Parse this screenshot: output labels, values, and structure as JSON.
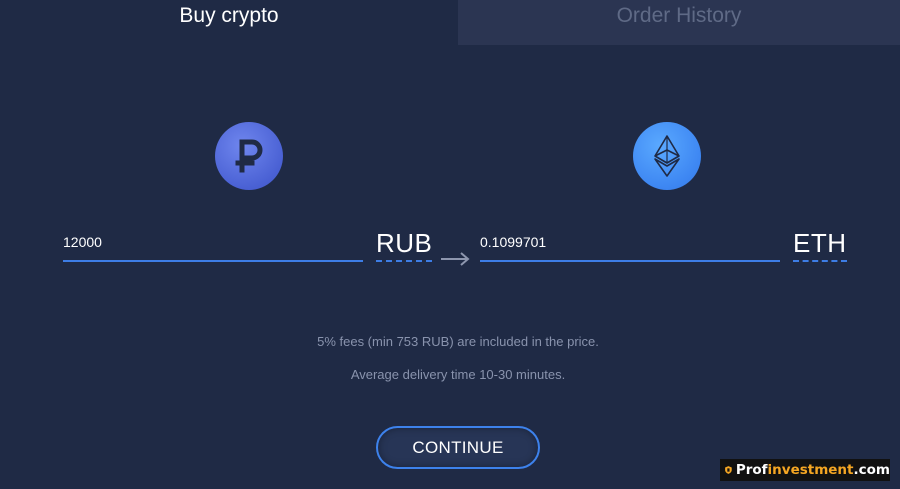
{
  "tabs": {
    "buy_label": "Buy crypto",
    "history_label": "Order History"
  },
  "from": {
    "amount": "12000",
    "currency": "RUB",
    "icon": "ruble-icon",
    "color": "#4a61d4"
  },
  "to": {
    "amount": "0.1099701",
    "currency": "ETH",
    "icon": "ethereum-icon",
    "color": "#3d86f2"
  },
  "info": {
    "fees": "5% fees (min 753 RUB) are included in the price.",
    "delivery": "Average delivery time 10-30 minutes."
  },
  "actions": {
    "continue_label": "CONTINUE"
  },
  "watermark": {
    "prefix": "Prof",
    "accent": "investment",
    "suffix": ".com"
  },
  "colors": {
    "background": "#1f2a45",
    "accent": "#3d7de6",
    "muted_text": "#8993ad"
  }
}
